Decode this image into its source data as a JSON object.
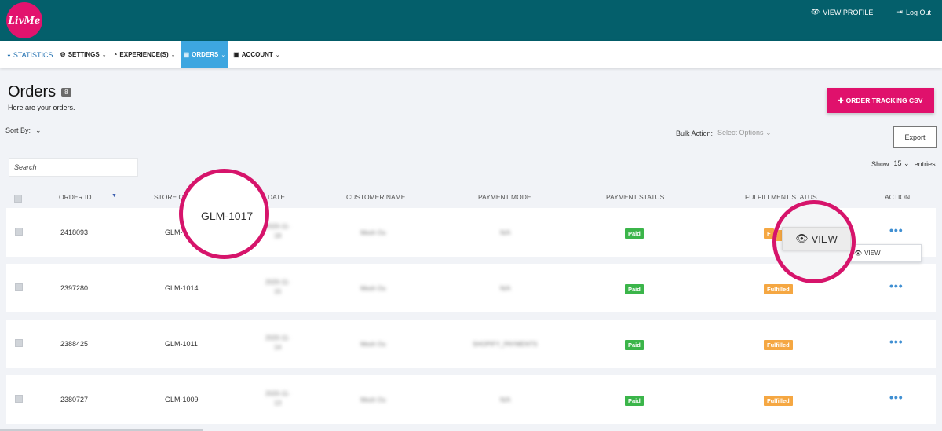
{
  "brand": {
    "logo_text": "LivMe",
    "accent": "#e0116c",
    "topbar_color": "#045f6b",
    "nav_active_color": "#3da6e0"
  },
  "top_links": {
    "view_profile": "VIEW PROFILE",
    "logout": "Log Out"
  },
  "nav": {
    "statistics": "STATISTICS",
    "settings": "SETTINGS",
    "experiences": "EXPERIENCE(S)",
    "orders": "ORDERS",
    "account": "ACCOUNT"
  },
  "header": {
    "title": "Orders",
    "count": "8",
    "subtitle": "Here are your orders.",
    "csv_button": "ORDER TRACKING CSV",
    "sort_by": "Sort By:",
    "bulk_action": "Bulk Action:",
    "bulk_placeholder": "Select Options",
    "export": "Export",
    "search_placeholder": "Search",
    "show": "Show",
    "entries_value": "15",
    "entries": "entries"
  },
  "columns": {
    "order_id": "ORDER ID",
    "store_order": "STORE O",
    "date": "DATE",
    "customer_name": "CUSTOMER NAME",
    "payment_mode": "PAYMENT MODE",
    "payment_status": "PAYMENT STATUS",
    "fulfillment_status": "FULFILLMENT STATUS",
    "action": "ACTION"
  },
  "rows": [
    {
      "order_id": "2418093",
      "store_order": "GLM-",
      "date_line1": "2020-11-",
      "date_line2": "18",
      "customer": "Mesh Ou",
      "payment_mode": "N/A",
      "payment_status": "Paid",
      "fulfillment": "F"
    },
    {
      "order_id": "2397280",
      "store_order": "GLM-1014",
      "date_line1": "2020-11-",
      "date_line2": "15",
      "customer": "Mesh Ou",
      "payment_mode": "N/A",
      "payment_status": "Paid",
      "fulfillment": "Fulfilled"
    },
    {
      "order_id": "2388425",
      "store_order": "GLM-1011",
      "date_line1": "2020-11-",
      "date_line2": "14",
      "customer": "Mesh Ou",
      "payment_mode": "SHOPIFY_PAYMENTS",
      "payment_status": "Paid",
      "fulfillment": "Fulfilled"
    },
    {
      "order_id": "2380727",
      "store_order": "GLM-1009",
      "date_line1": "2020-11-",
      "date_line2": "13",
      "customer": "Mesh Ou",
      "payment_mode": "N/A",
      "payment_status": "Paid",
      "fulfillment": "Fulfilled"
    }
  ],
  "dropdown": {
    "view": "VIEW"
  },
  "zoom": {
    "order_label": "GLM-1017",
    "view_label": "VIEW"
  },
  "icons": {
    "eye": "eye-icon",
    "logout": "logout-icon",
    "dashboard": "dashboard-icon",
    "gear": "gear-icon",
    "orders": "orders-icon",
    "account": "account-icon"
  }
}
